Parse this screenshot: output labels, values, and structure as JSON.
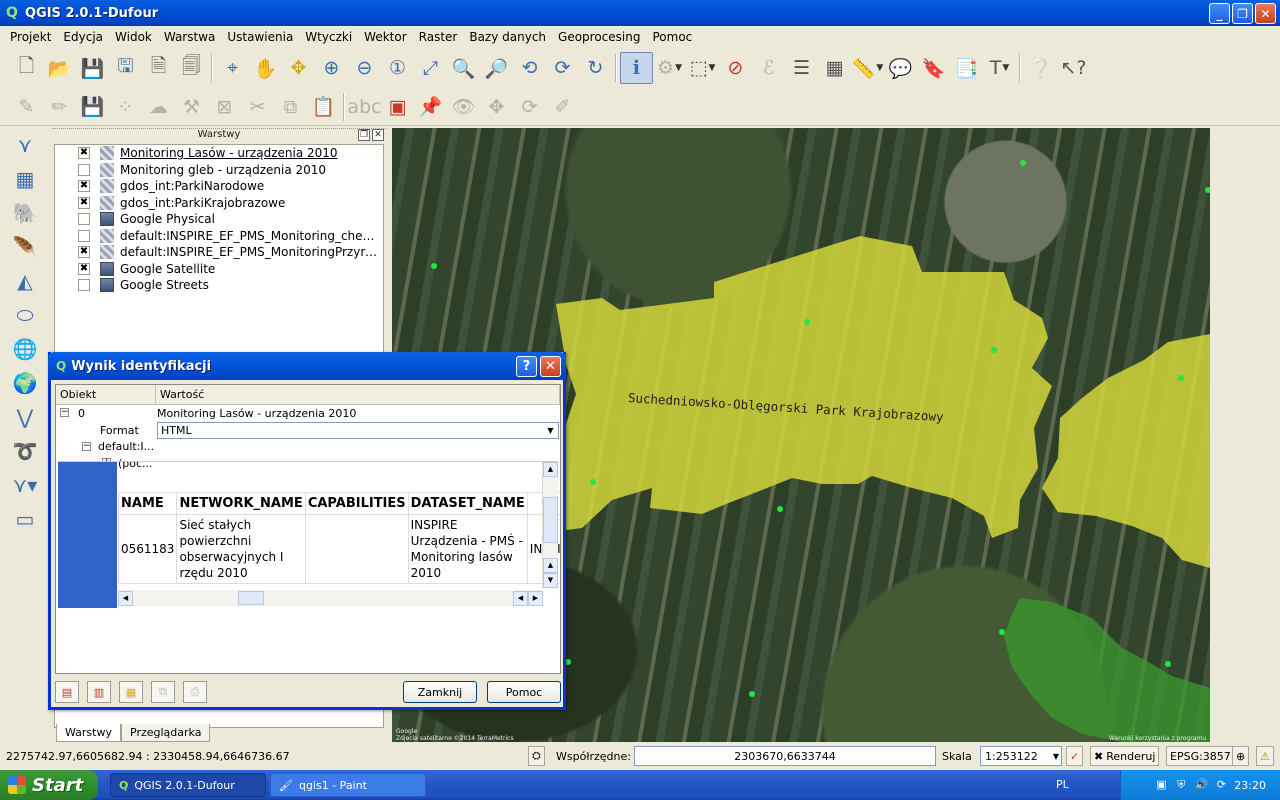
{
  "window": {
    "title": "QGIS 2.0.1-Dufour",
    "min": "_",
    "max": "❐",
    "close": "✕"
  },
  "menu": [
    "Projekt",
    "Edycja",
    "Widok",
    "Warstwa",
    "Ustawienia",
    "Wtyczki",
    "Wektor",
    "Raster",
    "Bazy danych",
    "Geoprocesing",
    "Pomoc"
  ],
  "layers_panel": {
    "title": "Warstwy",
    "layers": [
      {
        "name": "Monitoring Lasów - urządzenia 2010",
        "checked": true,
        "type": "raster",
        "active": true
      },
      {
        "name": "Monitoring gleb - urządzenia 2010",
        "checked": false,
        "type": "raster",
        "active": false
      },
      {
        "name": "gdos_int:ParkiNarodowe",
        "checked": true,
        "type": "raster",
        "active": false
      },
      {
        "name": "gdos_int:ParkiKrajobrazowe",
        "checked": true,
        "type": "raster",
        "active": false
      },
      {
        "name": "Google Physical",
        "checked": false,
        "type": "wms",
        "active": false
      },
      {
        "name": "default:INSPIRE_EF_PMS_Monitoring_chemi...",
        "checked": false,
        "type": "raster",
        "active": false
      },
      {
        "name": "default:INSPIRE_EF_PMS_MonitoringPrzyrod...",
        "checked": true,
        "type": "raster",
        "active": false
      },
      {
        "name": "Google Satellite",
        "checked": true,
        "type": "wms",
        "active": false
      },
      {
        "name": "Google Streets",
        "checked": false,
        "type": "wms",
        "active": false
      }
    ],
    "tabs": [
      "Warstwy",
      "Przeglądarka"
    ]
  },
  "map": {
    "label": "Suchedniowsko-Oblęgorski Park Krajobrazowy",
    "attrib_left": "Zdjęcia satelitarne ©2014 TerraMetrics",
    "attrib_right": "Warunki korzystania z programu",
    "google": "Google",
    "colors": {
      "park_fill": "#d8dc3a",
      "national_park": "#3b9a2f",
      "points": "#22e844"
    }
  },
  "identify": {
    "title": "Wynik identyfikacji",
    "col_object": "Obiekt",
    "col_value": "Wartość",
    "root_id": "0",
    "root_value": "Monitoring Lasów - urządzenia 2010",
    "format_label": "Format",
    "format_value": "HTML",
    "child_label": "default:I...",
    "grandchild_label": "(poc...",
    "table": {
      "headers": [
        "NAME",
        "NETWORK_NAME",
        "CAPABILITIES",
        "DATASET_NAME",
        ""
      ],
      "row": [
        "0561183",
        "Sieć stałych powierzchni obserwacyjnych I rzędu 2010",
        "",
        "INSPIRE Urządzenia - PMŚ - Monitoring lasów 2010",
        "INSPIRE_"
      ]
    },
    "close_label": "Zamknij",
    "help_label": "Pomoc"
  },
  "status": {
    "extent": "2275742.97,6605682.94 : 2330458.94,6646736.67",
    "coord_label": "Współrzędne:",
    "coord_value": "2303670,6633744",
    "scale_label": "Skala",
    "scale_value": "1:253122",
    "render_label": "Renderuj",
    "epsg": "EPSG:3857"
  },
  "taskbar": {
    "start": "Start",
    "tasks": [
      "QGIS 2.0.1-Dufour",
      "qgis1 - Paint"
    ],
    "lang": "PL",
    "clock": "23:20"
  }
}
